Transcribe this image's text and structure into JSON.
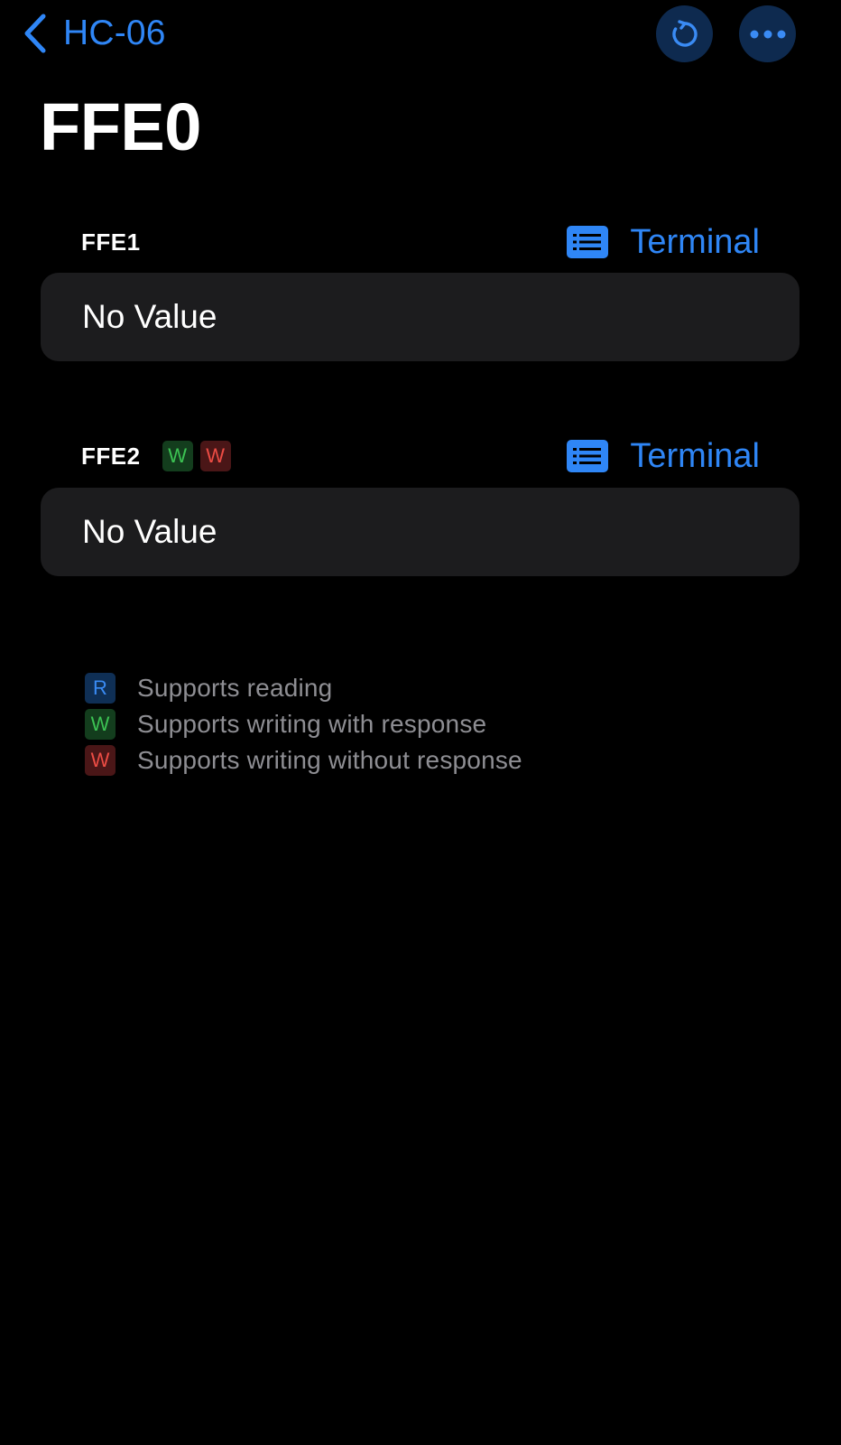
{
  "nav": {
    "back_label": "HC-06",
    "back_icon": "chevron-left-icon",
    "refresh_icon": "refresh-icon",
    "more_icon": "ellipsis-icon"
  },
  "title": "FFE0",
  "characteristics": [
    {
      "name": "FFE1",
      "badges": [],
      "terminal_label": "Terminal",
      "value": "No Value"
    },
    {
      "name": "FFE2",
      "badges": [
        {
          "letter": "W",
          "meaning": "write-with-response"
        },
        {
          "letter": "W",
          "meaning": "write-without-response"
        }
      ],
      "terminal_label": "Terminal",
      "value": "No Value"
    }
  ],
  "legend": [
    {
      "letter": "R",
      "text": "Supports reading"
    },
    {
      "letter": "W",
      "text": "Supports writing with response"
    },
    {
      "letter": "W",
      "text": "Supports writing without response"
    }
  ],
  "colors": {
    "background": "#000000",
    "accent_blue": "#2f86f6",
    "card": "#1c1c1e",
    "secondary_text": "#8e8e93",
    "badge_green": "#3cc253",
    "badge_red": "#ec4c44",
    "badge_blue": "#3a8bf4"
  }
}
